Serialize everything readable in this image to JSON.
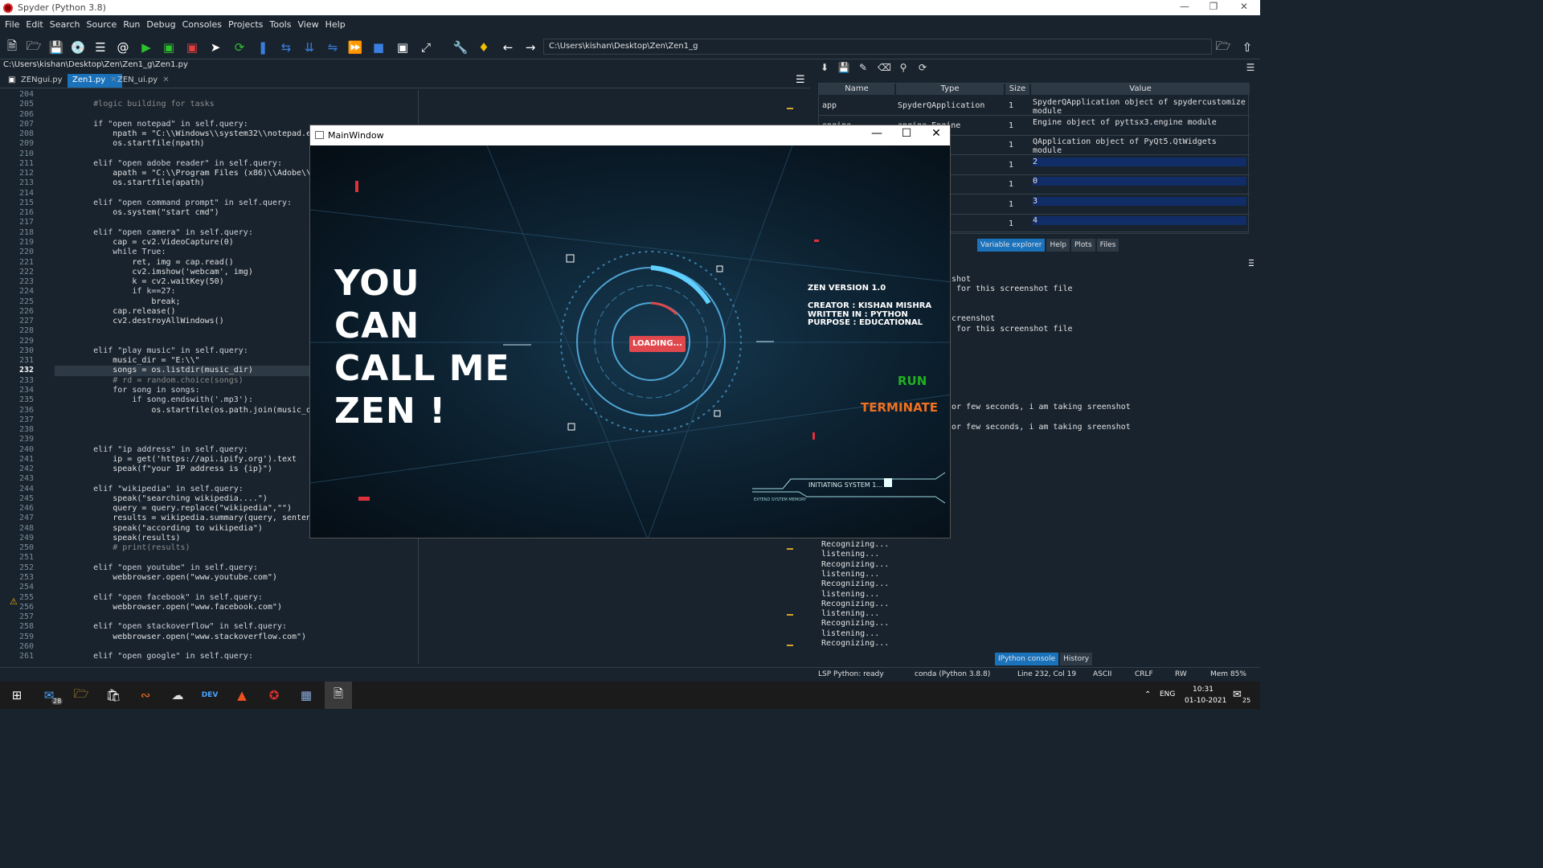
{
  "window": {
    "title": "Spyder (Python 3.8)"
  },
  "menu": [
    "File",
    "Edit",
    "Search",
    "Source",
    "Run",
    "Debug",
    "Consoles",
    "Projects",
    "Tools",
    "View",
    "Help"
  ],
  "toolbar": {
    "path": "C:\\Users\\kishan\\Desktop\\Zen\\Zen1_g"
  },
  "editor": {
    "file_path": "C:\\Users\\kishan\\Desktop\\Zen\\Zen1_g\\Zen1.py",
    "tabs": [
      {
        "label": "ZENgui.py"
      },
      {
        "label": "Zen1.py"
      },
      {
        "label": "ZEN_ui.py"
      }
    ],
    "line_numbers": [
      "204",
      "205",
      "206",
      "207",
      "208",
      "209",
      "210",
      "211",
      "212",
      "213",
      "214",
      "215",
      "216",
      "217",
      "218",
      "219",
      "220",
      "221",
      "222",
      "223",
      "224",
      "225",
      "226",
      "227",
      "228",
      "229",
      "230",
      "231",
      "232",
      "233",
      "234",
      "235",
      "236",
      "237",
      "238",
      "239",
      "240",
      "241",
      "242",
      "243",
      "244",
      "245",
      "246",
      "247",
      "248",
      "249",
      "250",
      "251",
      "252",
      "253",
      "254",
      "255",
      "256",
      "257",
      "258",
      "259",
      "260",
      "261"
    ],
    "lines": [
      "",
      "        #logic building for tasks",
      "",
      "        if \"open notepad\" in self.query:",
      "            npath = \"C:\\\\Windows\\\\system32\\\\notepad.exe\"",
      "            os.startfile(npath)",
      "",
      "        elif \"open adobe reader\" in self.query:",
      "            apath = \"C:\\\\Program Files (x86)\\\\Adobe\\\\Acrobat Reader DC\"",
      "            os.startfile(apath)",
      "",
      "        elif \"open command prompt\" in self.query:",
      "            os.system(\"start cmd\")",
      "",
      "        elif \"open camera\" in self.query:",
      "            cap = cv2.VideoCapture(0)",
      "            while True:",
      "                ret, img = cap.read()",
      "                cv2.imshow('webcam', img)",
      "                k = cv2.waitKey(50)",
      "                if k==27:",
      "                    break;",
      "            cap.release()",
      "            cv2.destroyAllWindows()",
      "",
      "",
      "        elif \"play music\" in self.query:",
      "            music_dir = \"E:\\\\\"",
      "            songs = os.listdir(music_dir)",
      "            # rd = random.choice(songs)",
      "            for song in songs:",
      "                if song.endswith('.mp3'):",
      "                    os.startfile(os.path.join(music_dir, song))",
      "",
      "",
      "",
      "        elif \"ip address\" in self.query:",
      "            ip = get('https://api.ipify.org').text",
      "            speak(f\"your IP address is {ip}\")",
      "",
      "        elif \"wikipedia\" in self.query:",
      "            speak(\"searching wikipedia....\")",
      "            query = query.replace(\"wikipedia\",\"\")",
      "            results = wikipedia.summary(query, sentences=2)",
      "            speak(\"according to wikipedia\")",
      "            speak(results)",
      "            # print(results)",
      "",
      "        elif \"open youtube\" in self.query:",
      "            webbrowser.open(\"www.youtube.com\")",
      "",
      "        elif \"open facebook\" in self.query:",
      "            webbrowser.open(\"www.facebook.com\")",
      "",
      "        elif \"open stackoverflow\" in self.query:",
      "            webbrowser.open(\"www.stackoverflow.com\")",
      "",
      "        elif \"open google\" in self.query:"
    ]
  },
  "variable_explorer": {
    "headers": [
      "Name",
      "Type",
      "Size",
      "Value"
    ],
    "rows": [
      {
        "name": "app",
        "type": "SpyderQApplication",
        "size": "1",
        "value": "SpyderQApplication object of spydercustomize module"
      },
      {
        "name": "engine",
        "type": "engine.Engine",
        "size": "1",
        "value": "Engine object of pyttsx3.engine module"
      },
      {
        "name": "",
        "type": "pplication",
        "size": "1",
        "value": "QApplication object of PyQt5.QtWidgets module"
      },
      {
        "name": "",
        "type": "Type",
        "size": "1",
        "value": "2"
      },
      {
        "name": "",
        "type": "Type",
        "size": "1",
        "value": "0"
      },
      {
        "name": "",
        "type": "Type",
        "size": "1",
        "value": "3"
      },
      {
        "name": "",
        "type": "Type",
        "size": "1",
        "value": "4"
      }
    ],
    "tabs": [
      "Variable explorer",
      "Help",
      "Plots",
      "Files"
    ]
  },
  "console": {
    "lines_top": [
      "shot",
      " for this screenshot file",
      "",
      "",
      "creenshot",
      " for this screenshot file"
    ],
    "lines_mid": [
      "or few seconds, i am taking sreenshot",
      "or few seconds, i am taking sreenshot"
    ],
    "lines_bottom": [
      "Recognizing...",
      "listening...",
      "Recognizing...",
      "listening...",
      "Recognizing...",
      "listening...",
      "Recognizing...",
      "listening...",
      "Recognizing...",
      "listening...",
      "Recognizing..."
    ],
    "tabs": [
      "IPython console",
      "History"
    ]
  },
  "statusbar": {
    "lsp": "LSP Python: ready",
    "conda": "conda (Python 3.8.8)",
    "position": "Line 232, Col 19",
    "encoding": "ASCII",
    "eol": "CRLF",
    "rw": "RW",
    "mem": "Mem 85%"
  },
  "mainwindow": {
    "title": "MainWindow",
    "big_lines": [
      "YOU",
      "CAN",
      "CALL ME",
      "ZEN !"
    ],
    "version": "ZEN VERSION 1.0",
    "creator": "CREATOR : KISHAN MISHRA",
    "written": "WRITTEN IN : PYTHON",
    "purpose": "PURPOSE : EDUCATIONAL",
    "run": "RUN",
    "terminate": "TERMINATE",
    "loading": "LOADING...",
    "initiating": "INITIATING SYSTEM 1...",
    "memory": "EXTEND SYSTEM MEMORY"
  },
  "taskbar": {
    "mail_badge": "28",
    "lang": "ENG",
    "time": "10:31",
    "date": "01-10-2021",
    "notif_count": "25"
  },
  "colors": {
    "background": "#19232d",
    "accent": "#1a72bb",
    "run": "#21b021",
    "terminate": "#f07020"
  }
}
